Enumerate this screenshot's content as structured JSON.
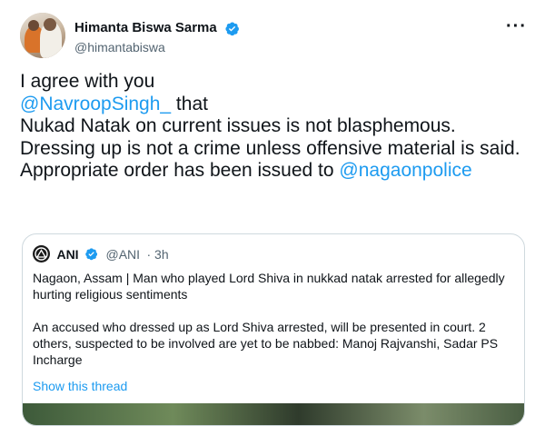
{
  "author": {
    "display_name": "Himanta Biswa Sarma",
    "handle": "@himantabiswa",
    "verified": true,
    "more_icon": "ellipsis-icon"
  },
  "tweet": {
    "line1": "I agree with you",
    "mention1": "@NavroopSingh_",
    "line2_suffix": " that",
    "line3": "Nukad Natak on current issues is not blasphemous.",
    "line4": "Dressing up is not a crime unless offensive material is said.",
    "line5_prefix": "Appropriate order has been issued to ",
    "mention2": "@nagaonpolice"
  },
  "quoted_tweet": {
    "display_name": "ANI",
    "handle": "@ANI",
    "time": "· 3h",
    "para1": "Nagaon, Assam | Man who played Lord Shiva in nukkad natak arrested for allegedly hurting religious sentiments",
    "para2": "An accused who dressed up as Lord Shiva arrested, will be presented in court. 2 others, suspected to be involved are yet to be nabbed: Manoj Rajvanshi, Sadar PS Incharge",
    "show_thread": "Show this thread"
  },
  "colors": {
    "link": "#1d9bf0",
    "text": "#0f1419",
    "muted": "#536471",
    "border": "#cfd9de"
  }
}
